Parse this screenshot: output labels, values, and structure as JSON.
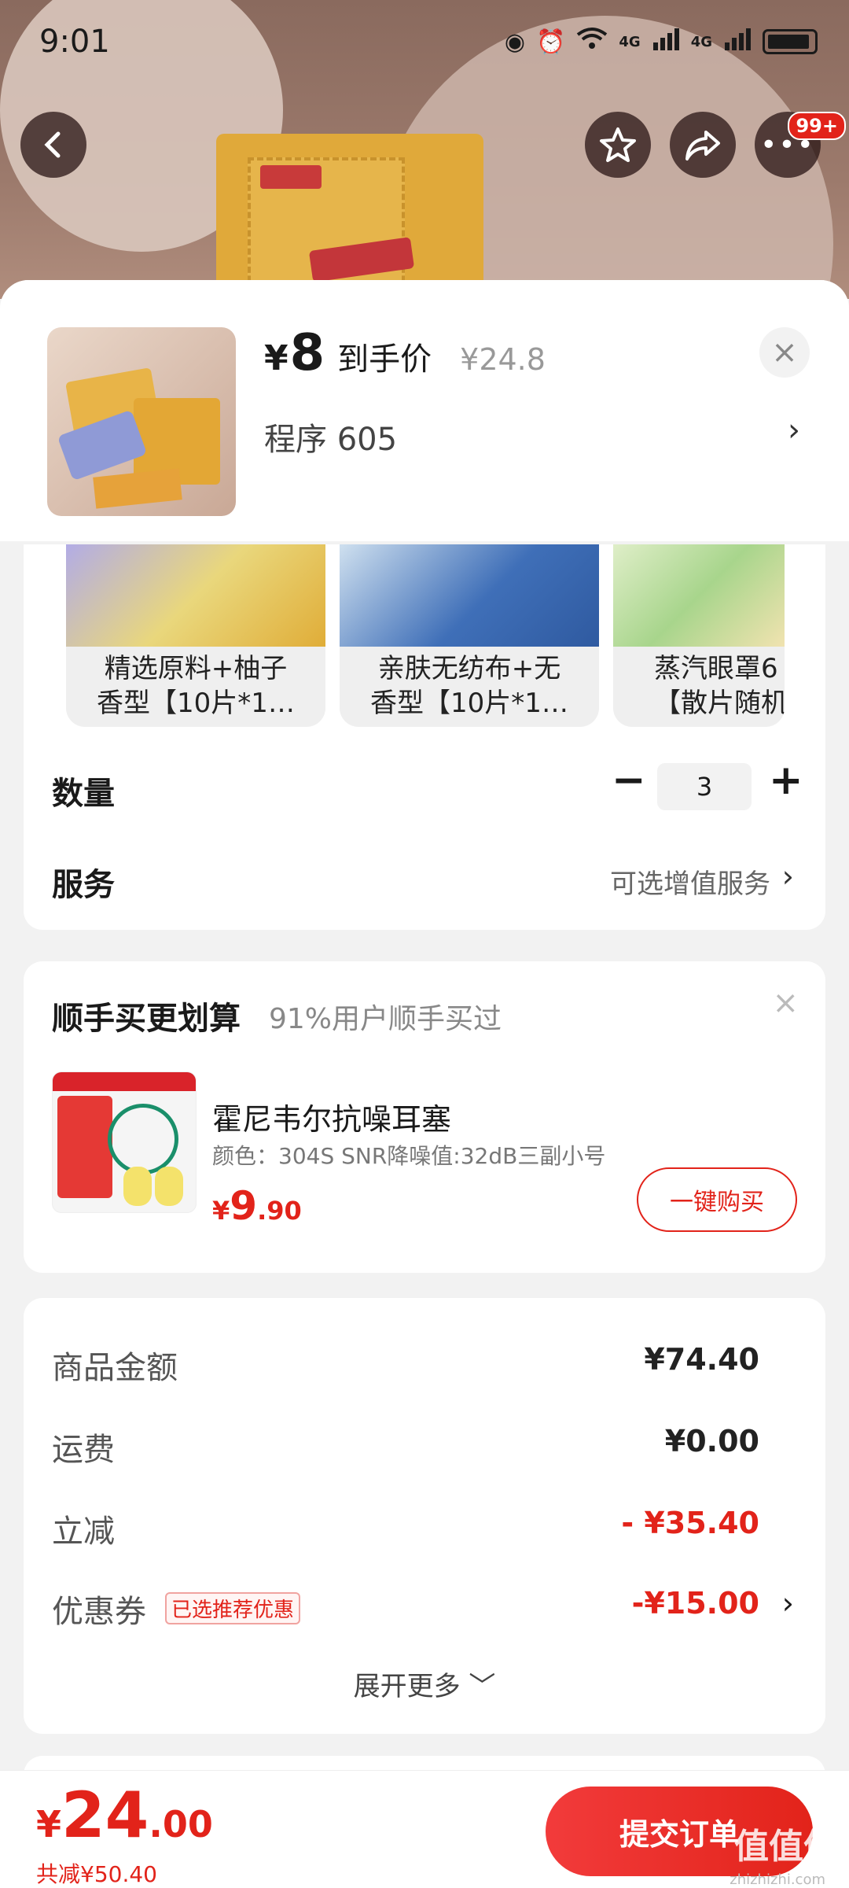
{
  "status_bar": {
    "time": "9:01",
    "net1": "4G",
    "net2": "4G"
  },
  "top_actions": {
    "back_icon": "back-icon",
    "more_badge": "99+"
  },
  "product": {
    "price_symbol": "¥",
    "price": "8",
    "price_label": "到手价",
    "original_price": "¥24.8",
    "spec": "程序  605",
    "close_symbol": "×",
    "arrow": "›"
  },
  "variants": [
    {
      "label": "精选原料+柚子\n香型【10片*1…"
    },
    {
      "label": "亲肤无纺布+无\n香型【10片*1…"
    },
    {
      "label": "蒸汽眼罩6\n【散片随机"
    }
  ],
  "quantity": {
    "label": "数量",
    "minus": "−",
    "value": "3",
    "plus": "+"
  },
  "service": {
    "label": "服务",
    "value": "可选增值服务",
    "arrow": "›"
  },
  "addon": {
    "title": "顺手买更划算",
    "subtitle": "91%用户顺手买过",
    "close": "×",
    "name": "霍尼韦尔抗噪耳塞",
    "spec": "颜色：304S SNR降噪值:32dB三副小号",
    "price_symbol": "¥",
    "price_int": "9",
    "price_dec": ".90",
    "button": "一键购买"
  },
  "summary": {
    "rows": [
      {
        "label": "商品金额",
        "value": "¥74.40"
      },
      {
        "label": "运费",
        "value": "¥0.00"
      },
      {
        "label": "立减",
        "value": "- ¥35.40"
      },
      {
        "label": "优惠券",
        "value": "-¥15.00",
        "tag": "已选推荐优惠",
        "arrow": "›"
      }
    ],
    "expand": "展开更多 ﹀"
  },
  "bottom": {
    "symbol": "¥",
    "total_int": "24",
    "total_dec": ".00",
    "saved": "共减¥50.40",
    "submit": "提交订单"
  },
  "watermark": {
    "text": "值值值",
    "sub": "zhizhizhi.com"
  },
  "colors": {
    "accent": "#e2231a",
    "background": "#f2f2f2"
  }
}
